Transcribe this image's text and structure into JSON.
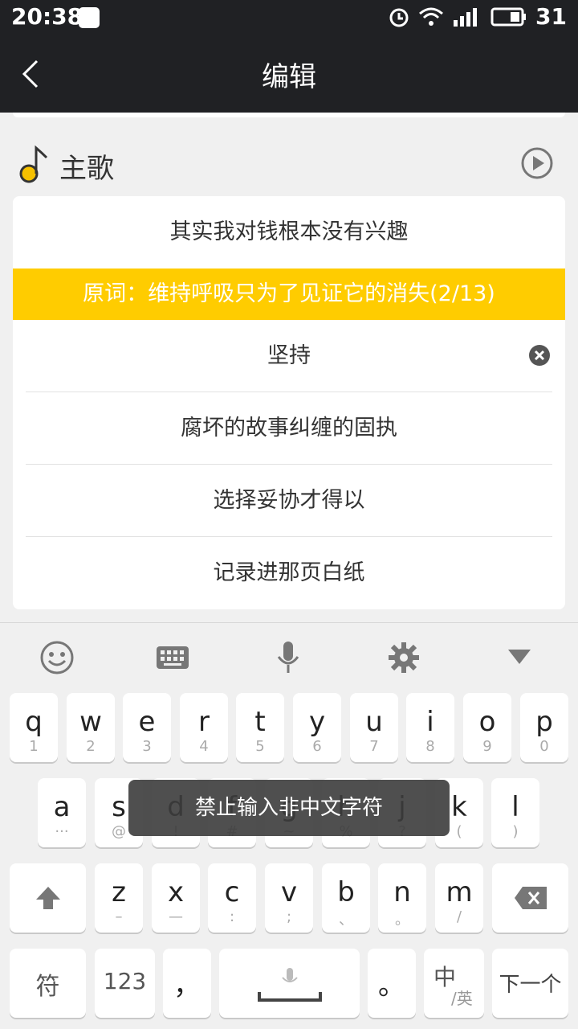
{
  "status_bar": {
    "time": "20:38",
    "battery": "31"
  },
  "app_bar": {
    "title": "编辑"
  },
  "section": {
    "label": "主歌"
  },
  "lyrics": {
    "current_line": "其实我对钱根本没有兴趣",
    "original_hint": "原词：维持呼吸只为了见证它的消失(2/13)",
    "editing_input": "坚持",
    "lines": [
      "腐坏的故事纠缠的固执",
      "选择妥协才得以",
      "记录进那页白纸"
    ]
  },
  "keyboard": {
    "row1": [
      {
        "k": "q",
        "s": "1"
      },
      {
        "k": "w",
        "s": "2"
      },
      {
        "k": "e",
        "s": "3"
      },
      {
        "k": "r",
        "s": "4"
      },
      {
        "k": "t",
        "s": "5"
      },
      {
        "k": "y",
        "s": "6"
      },
      {
        "k": "u",
        "s": "7"
      },
      {
        "k": "i",
        "s": "8"
      },
      {
        "k": "o",
        "s": "9"
      },
      {
        "k": "p",
        "s": "0"
      }
    ],
    "row2": [
      {
        "k": "a",
        "s": "···"
      },
      {
        "k": "s",
        "s": "@"
      },
      {
        "k": "d",
        "s": "!"
      },
      {
        "k": "f",
        "s": "#"
      },
      {
        "k": "g",
        "s": "~"
      },
      {
        "k": "h",
        "s": "%"
      },
      {
        "k": "j",
        "s": "?"
      },
      {
        "k": "k",
        "s": "("
      },
      {
        "k": "l",
        "s": ")"
      }
    ],
    "row3": [
      {
        "k": "z",
        "s": "–"
      },
      {
        "k": "x",
        "s": "—"
      },
      {
        "k": "c",
        "s": ":"
      },
      {
        "k": "v",
        "s": ";"
      },
      {
        "k": "b",
        "s": "、"
      },
      {
        "k": "n",
        "s": "。"
      },
      {
        "k": "m",
        "s": "/"
      }
    ],
    "bottom": {
      "symbols": "符",
      "numbers": "123",
      "comma": "，",
      "period": "。",
      "lang_main": "中",
      "lang_sub": "/英",
      "next": "下一个"
    }
  },
  "toast": {
    "message": "禁止输入非中文字符"
  },
  "colors": {
    "accent": "#ffcc00",
    "dark_bar": "#202124",
    "note_icon": "#f6c100"
  }
}
